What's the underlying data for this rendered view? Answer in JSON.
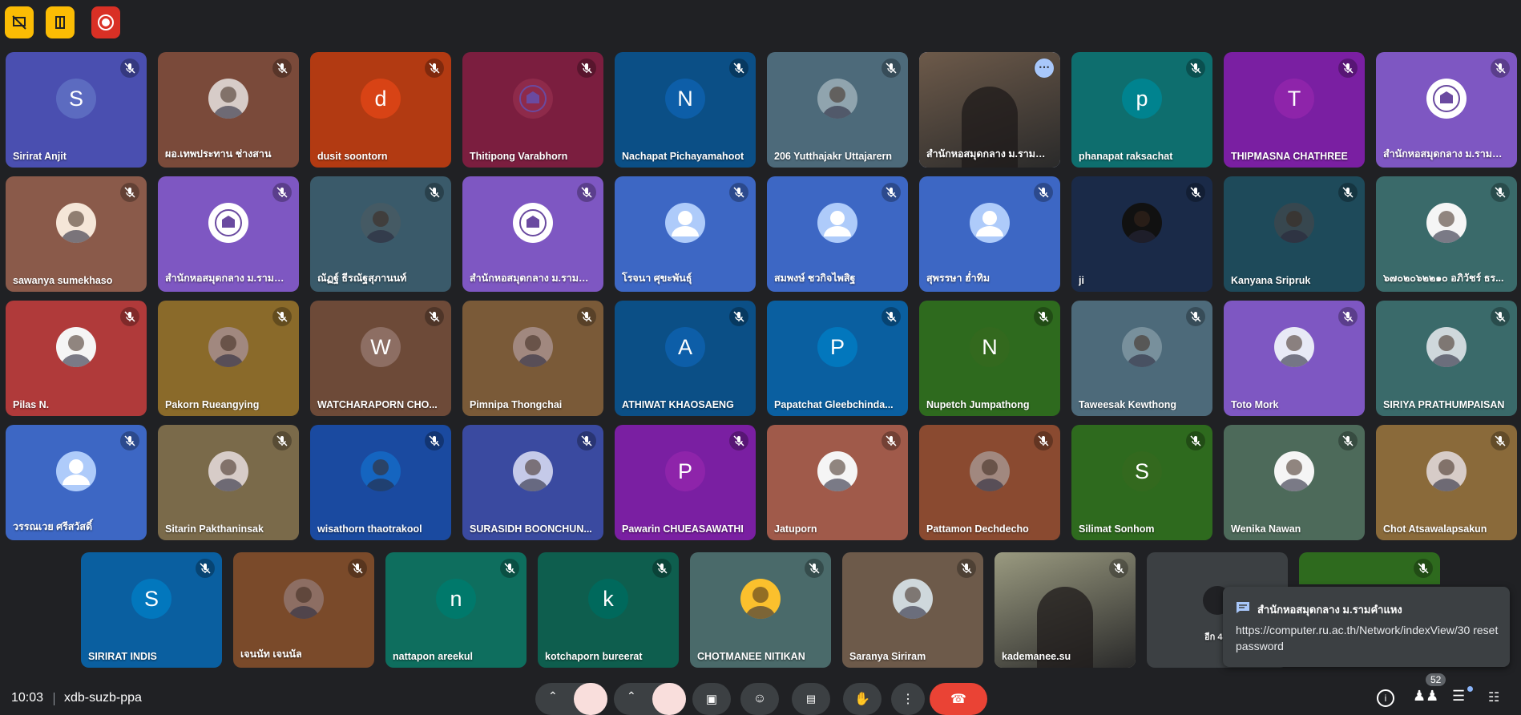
{
  "meeting": {
    "time": "10:03",
    "code": "xdb-suzb-ppa"
  },
  "colors": {
    "toolbar_yellow": "#fbbc04",
    "record_red": "#d93025",
    "active_outline": "#a8c7fa",
    "leave_red": "#ea4335"
  },
  "top_buttons": [
    {
      "icon": "no-share-icon"
    },
    {
      "icon": "building-icon"
    },
    {
      "icon": "record-icon"
    }
  ],
  "participants": [
    {
      "name": "Sirirat Anjit",
      "initial": "S",
      "bg": "#4a4fb0",
      "av_bg": "#5c6bc0",
      "type": "letter"
    },
    {
      "name": "ผอ.เทพประทาน ช่างสาน",
      "initial": "",
      "bg": "#7a4a3a",
      "av_bg": "#d7ccc8",
      "type": "photo"
    },
    {
      "name": "dusit soontorn",
      "initial": "d",
      "bg": "#b23a12",
      "av_bg": "#d84315",
      "type": "letter"
    },
    {
      "name": "Thitipong Varabhorn",
      "initial": "",
      "bg": "#7b1e3f",
      "av_bg": "#8e2a4a",
      "type": "logo"
    },
    {
      "name": "Nachapat Pichayamahoot",
      "initial": "N",
      "bg": "#0b4f86",
      "av_bg": "#0d5ea8",
      "type": "letter"
    },
    {
      "name": "206 Yutthajakr Uttajarern",
      "initial": "",
      "bg": "#4d6a7a",
      "av_bg": "#90a4ae",
      "type": "photo"
    },
    {
      "name": "สำนักหอสมุดกลาง ม.รามคำ...",
      "initial": "",
      "bg": "#6d5a4a",
      "av_bg": "#8d6e63",
      "type": "video"
    },
    {
      "name": "phanapat raksachat",
      "initial": "p",
      "bg": "#0e6e6e",
      "av_bg": "#00838f",
      "type": "letter"
    },
    {
      "name": "THIPMASNA CHATHREE",
      "initial": "T",
      "bg": "#7a1fa2",
      "av_bg": "#8e24aa",
      "type": "letter"
    },
    {
      "name": "สำนักหอสมุดกลาง ม.รามคำ...",
      "initial": "",
      "bg": "#7e57c2",
      "av_bg": "#ffffff",
      "type": "logo"
    },
    {
      "name": "sawanya sumekhaso",
      "initial": "",
      "bg": "#8a5a4a",
      "av_bg": "#f5e6d8",
      "type": "photo"
    },
    {
      "name": "สำนักหอสมุดกลาง ม.รามคำ...",
      "initial": "",
      "bg": "#7e57c2",
      "av_bg": "#ffffff",
      "type": "logo"
    },
    {
      "name": "ณัฏฐ์ ธีรณัฐสุภานนท์",
      "initial": "",
      "bg": "#3a5a6a",
      "av_bg": "#455a64",
      "type": "photo"
    },
    {
      "name": "สำนักหอสมุดกลาง ม.รามคำ...",
      "initial": "",
      "bg": "#7e57c2",
      "av_bg": "#ffffff",
      "type": "logo"
    },
    {
      "name": "โรจนา ศุขะพันธุ์",
      "initial": "",
      "bg": "#3d67c4",
      "av_bg": "#aecbfa",
      "type": "default"
    },
    {
      "name": "สมพงษ์ ชวกิจไพสิฐ",
      "initial": "",
      "bg": "#3d67c4",
      "av_bg": "#aecbfa",
      "type": "default"
    },
    {
      "name": "สุพรรษา ฮ่ำทิม",
      "initial": "",
      "bg": "#3d67c4",
      "av_bg": "#aecbfa",
      "type": "default"
    },
    {
      "name": "ji",
      "initial": "",
      "bg": "#1a2a48",
      "av_bg": "#111111",
      "type": "photo"
    },
    {
      "name": "Kanyana Sripruk",
      "initial": "",
      "bg": "#1e4a5a",
      "av_bg": "#37474f",
      "type": "photo"
    },
    {
      "name": "๖๗๐๒๐๖๒๒๑๐ อภิวัชร์ ธร...",
      "initial": "",
      "bg": "#3a6a6a",
      "av_bg": "#f5f5f5",
      "type": "photo"
    },
    {
      "name": "Pilas N.",
      "initial": "",
      "bg": "#b03a3a",
      "av_bg": "#f5f5f5",
      "type": "photo"
    },
    {
      "name": "Pakorn Rueangying",
      "initial": "",
      "bg": "#8a6a2a",
      "av_bg": "#a1887f",
      "type": "photo"
    },
    {
      "name": "WATCHARAPORN CHO...",
      "initial": "W",
      "bg": "#6d4a38",
      "av_bg": "#8d6e63",
      "type": "letter"
    },
    {
      "name": "Pimnipa Thongchai",
      "initial": "",
      "bg": "#7a5a38",
      "av_bg": "#a1887f",
      "type": "photo"
    },
    {
      "name": "ATHIWAT KHAOSAENG",
      "initial": "A",
      "bg": "#0b4f86",
      "av_bg": "#0d5ea8",
      "type": "letter"
    },
    {
      "name": "Papatchat Gleebchinda...",
      "initial": "P",
      "bg": "#0a5fa0",
      "av_bg": "#0277bd",
      "type": "letter"
    },
    {
      "name": "Nupetch Jumpathong",
      "initial": "N",
      "bg": "#2e6a1e",
      "av_bg": "#33691e",
      "type": "letter"
    },
    {
      "name": "Taweesak Kewthong",
      "initial": "",
      "bg": "#4d6a7a",
      "av_bg": "#78909c",
      "type": "photo"
    },
    {
      "name": "Toto Mork",
      "initial": "",
      "bg": "#7e57c2",
      "av_bg": "#e8eaf6",
      "type": "photo"
    },
    {
      "name": "SIRIYA PRATHUMPAISAN",
      "initial": "",
      "bg": "#3a6a6a",
      "av_bg": "#cfd8dc",
      "type": "photo"
    },
    {
      "name": "วรรณเวย ศรีสวัสดิ์",
      "initial": "",
      "bg": "#3d67c4",
      "av_bg": "#aecbfa",
      "type": "default"
    },
    {
      "name": "Sitarin Pakthaninsak",
      "initial": "",
      "bg": "#7a6a4a",
      "av_bg": "#d7ccc8",
      "type": "photo"
    },
    {
      "name": "wisathorn thaotrakool",
      "initial": "",
      "bg": "#1a4aa0",
      "av_bg": "#1565c0",
      "type": "photo"
    },
    {
      "name": "SURASIDH BOONCHUN...",
      "initial": "",
      "bg": "#3a4aa0",
      "av_bg": "#c5cae9",
      "type": "photo"
    },
    {
      "name": "Pawarin CHUEASAWATHI",
      "initial": "P",
      "bg": "#7a1fa2",
      "av_bg": "#8e24aa",
      "type": "letter"
    },
    {
      "name": "Jatuporn",
      "initial": "",
      "bg": "#a05a4a",
      "av_bg": "#f5f5f5",
      "type": "photo"
    },
    {
      "name": "Pattamon Dechdecho",
      "initial": "",
      "bg": "#8a4a30",
      "av_bg": "#a1887f",
      "type": "photo"
    },
    {
      "name": "Silimat Sonhom",
      "initial": "S",
      "bg": "#2e6a1e",
      "av_bg": "#33691e",
      "type": "letter"
    },
    {
      "name": "Wenika Nawan",
      "initial": "",
      "bg": "#4d6a5a",
      "av_bg": "#f5f5f5",
      "type": "photo"
    },
    {
      "name": "Chot Atsawalapsakun",
      "initial": "",
      "bg": "#8a6a3a",
      "av_bg": "#d7ccc8",
      "type": "photo"
    }
  ],
  "participants_row5": [
    {
      "name": "SIRIRAT INDIS",
      "initial": "S",
      "bg": "#0a5fa0",
      "av_bg": "#0277bd",
      "type": "letter"
    },
    {
      "name": "เจนนัท เจนนัล",
      "initial": "",
      "bg": "#7a4a2a",
      "av_bg": "#8d6e63",
      "type": "photo"
    },
    {
      "name": "nattapon areekul",
      "initial": "n",
      "bg": "#0e6e5e",
      "av_bg": "#00796b",
      "type": "letter"
    },
    {
      "name": "kotchaporn bureerat",
      "initial": "k",
      "bg": "#0e5e4e",
      "av_bg": "#00695c",
      "type": "letter"
    },
    {
      "name": "CHOTMANEE NITIKAN",
      "initial": "",
      "bg": "#4a6a6a",
      "av_bg": "#fbc02d",
      "type": "photo"
    },
    {
      "name": "Saranya Siriram",
      "initial": "",
      "bg": "#6d5a4a",
      "av_bg": "#cfd8dc",
      "type": "photo"
    },
    {
      "name": "kademanee.su",
      "initial": "",
      "bg": "#9a9a80",
      "av_bg": "#9a9a80",
      "type": "video"
    },
    {
      "name": "อีก 4",
      "initial": "",
      "bg": "#3c4043",
      "av_bg": "#3c4043",
      "type": "more"
    },
    {
      "name": "",
      "initial": "",
      "bg": "#2e6a1e",
      "av_bg": "#33691e",
      "type": "blank"
    }
  ],
  "chat_toast": {
    "sender": "สำนักหอสมุดกลาง ม.รามคำแหง",
    "message": "https://computer.ru.ac.th/Network/indexView/30 reset password"
  },
  "participant_count": "52",
  "controls": {
    "mic": "mic-off-icon",
    "camera": "camera-off-icon",
    "present": "present-icon",
    "emoji": "emoji-icon",
    "captions": "captions-icon",
    "hand": "raise-hand-icon",
    "more": "more-options-icon",
    "leave": "end-call-icon",
    "info": "info-icon",
    "people": "people-icon",
    "chat": "chat-icon",
    "apps": "apps-icon"
  }
}
